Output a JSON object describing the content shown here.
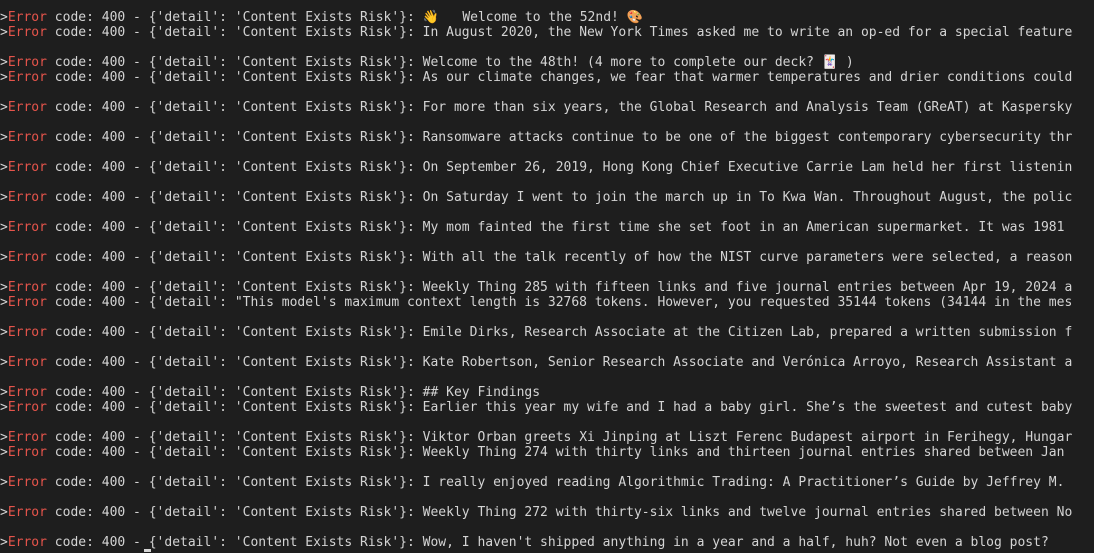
{
  "terminal": {
    "error_word": "Error",
    "prompt_marker": ">",
    "lines": [
      {
        "prefix": " code: 400 - {'detail': 'Content Exists Risk'}: ",
        "message": "👋   Welcome to the 52nd! 🎨"
      },
      {
        "prefix": " code: 400 - {'detail': 'Content Exists Risk'}: ",
        "message": "In August 2020, the New York Times asked me to write an op-ed for a special feature"
      },
      {
        "prefix": " code: 400 - {'detail': 'Content Exists Risk'}: ",
        "message": "Welcome to the 48th! (4 more to complete our deck? 🃏 )"
      },
      {
        "prefix": " code: 400 - {'detail': 'Content Exists Risk'}: ",
        "message": "As our climate changes, we fear that warmer temperatures and drier conditions could"
      },
      {
        "prefix": " code: 400 - {'detail': 'Content Exists Risk'}: ",
        "message": "For more than six years, the Global Research and Analysis Team (GReAT) at Kaspersky"
      },
      {
        "prefix": " code: 400 - {'detail': 'Content Exists Risk'}: ",
        "message": "Ransomware attacks continue to be one of the biggest contemporary cybersecurity thr"
      },
      {
        "prefix": " code: 400 - {'detail': 'Content Exists Risk'}: ",
        "message": "On September 26, 2019, Hong Kong Chief Executive Carrie Lam held her first listenin"
      },
      {
        "prefix": " code: 400 - {'detail': 'Content Exists Risk'}: ",
        "message": "On Saturday I went to join the march up in To Kwa Wan. Throughout August, the polic"
      },
      {
        "prefix": " code: 400 - {'detail': 'Content Exists Risk'}: ",
        "message": "My mom fainted the first time she set foot in an American supermarket. It was 1981"
      },
      {
        "prefix": " code: 400 - {'detail': 'Content Exists Risk'}: ",
        "message": "With all the talk recently of how the NIST curve parameters were selected, a reason"
      },
      {
        "prefix": " code: 400 - {'detail': 'Content Exists Risk'}: ",
        "message": "Weekly Thing 285 with fifteen links and five journal entries between Apr 19, 2024 a"
      },
      {
        "prefix": " code: 400 - {'detail': ",
        "message": "\"This model's maximum context length is 32768 tokens. However, you requested 35144 tokens (34144 in the mes"
      },
      {
        "prefix": " code: 400 - {'detail': 'Content Exists Risk'}: ",
        "message": "Emile Dirks, Research Associate at the Citizen Lab, prepared a written submission f"
      },
      {
        "prefix": " code: 400 - {'detail': 'Content Exists Risk'}: ",
        "message": "Kate Robertson, Senior Research Associate and Verónica Arroyo, Research Assistant a"
      },
      {
        "prefix": " code: 400 - {'detail': 'Content Exists Risk'}: ",
        "message": "## Key Findings"
      },
      {
        "prefix": " code: 400 - {'detail': 'Content Exists Risk'}: ",
        "message": "Earlier this year my wife and I had a baby girl. She’s the sweetest and cutest baby"
      },
      {
        "prefix": " code: 400 - {'detail': 'Content Exists Risk'}: ",
        "message": "Viktor Orban greets Xi Jinping at Liszt Ferenc Budapest airport in Ferihegy, Hungar"
      },
      {
        "prefix": " code: 400 - {'detail': 'Content Exists Risk'}: ",
        "message": "Weekly Thing 274 with thirty links and thirteen journal entries shared between Jan"
      },
      {
        "prefix": " code: 400 - {'detail': 'Content Exists Risk'}: ",
        "message": "I really enjoyed reading Algorithmic Trading: A Practitioner’s Guide by Jeffrey M."
      },
      {
        "prefix": " code: 400 - {'detail': 'Content Exists Risk'}: ",
        "message": "Weekly Thing 272 with thirty-six links and twelve journal entries shared between No"
      },
      {
        "prefix": " code: 400 - {'detail': 'Content Exists Risk'}: ",
        "message": "Wow, I haven't shipped anything in a year and a half, huh? Not even a blog post?"
      }
    ]
  }
}
